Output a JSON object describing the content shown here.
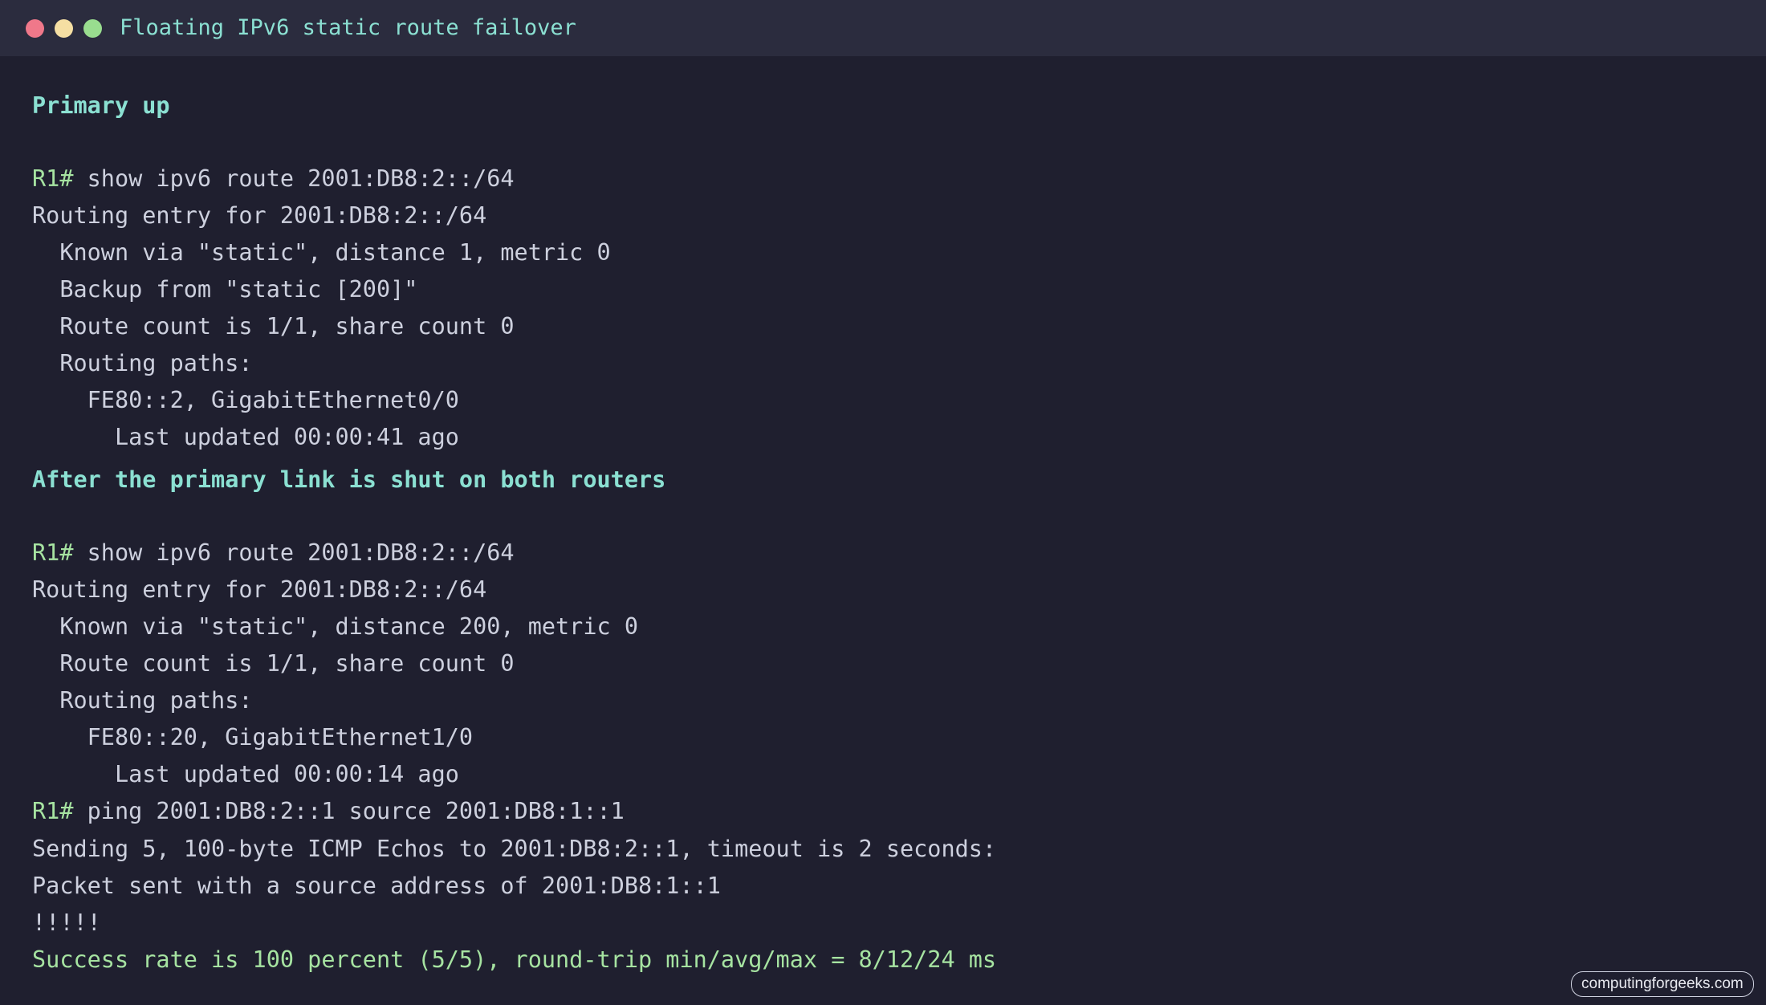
{
  "window": {
    "title": "Floating IPv6 static route failover",
    "controls": [
      {
        "name": "close",
        "color": "#f0788a"
      },
      {
        "name": "minimize",
        "color": "#f5dfa3"
      },
      {
        "name": "zoom",
        "color": "#99dd8f"
      }
    ]
  },
  "colors": {
    "background": "#1f1f2f",
    "titlebar": "#2b2c3e",
    "title_text": "#8be0d2",
    "heading": "#8be0d2",
    "prompt": "#a6e3a1",
    "output": "#cdd0de",
    "success": "#a6e3a1"
  },
  "sections": [
    {
      "heading": "Primary up",
      "command_prompt": "R1#",
      "command": " show ipv6 route 2001:DB8:2::/64",
      "output": [
        "Routing entry for 2001:DB8:2::/64",
        "  Known via \"static\", distance 1, metric 0",
        "  Backup from \"static [200]\"",
        "  Route count is 1/1, share count 0",
        "  Routing paths:",
        "    FE80::2, GigabitEthernet0/0",
        "      Last updated 00:00:41 ago"
      ]
    },
    {
      "heading": "After the primary link is shut on both routers",
      "command_prompt": "R1#",
      "command": " show ipv6 route 2001:DB8:2::/64",
      "output": [
        "Routing entry for 2001:DB8:2::/64",
        "  Known via \"static\", distance 200, metric 0",
        "  Route count is 1/1, share count 0",
        "  Routing paths:",
        "    FE80::20, GigabitEthernet1/0",
        "      Last updated 00:00:14 ago"
      ],
      "ping": {
        "command_prompt": "R1#",
        "command": " ping 2001:DB8:2::1 source 2001:DB8:1::1",
        "output": [
          "Sending 5, 100-byte ICMP Echos to 2001:DB8:2::1, timeout is 2 seconds:",
          "Packet sent with a source address of 2001:DB8:1::1",
          "!!!!!"
        ],
        "success": "Success rate is 100 percent (5/5), round-trip min/avg/max = 8/12/24 ms"
      }
    }
  ],
  "watermark": "computingforgeeks.com"
}
